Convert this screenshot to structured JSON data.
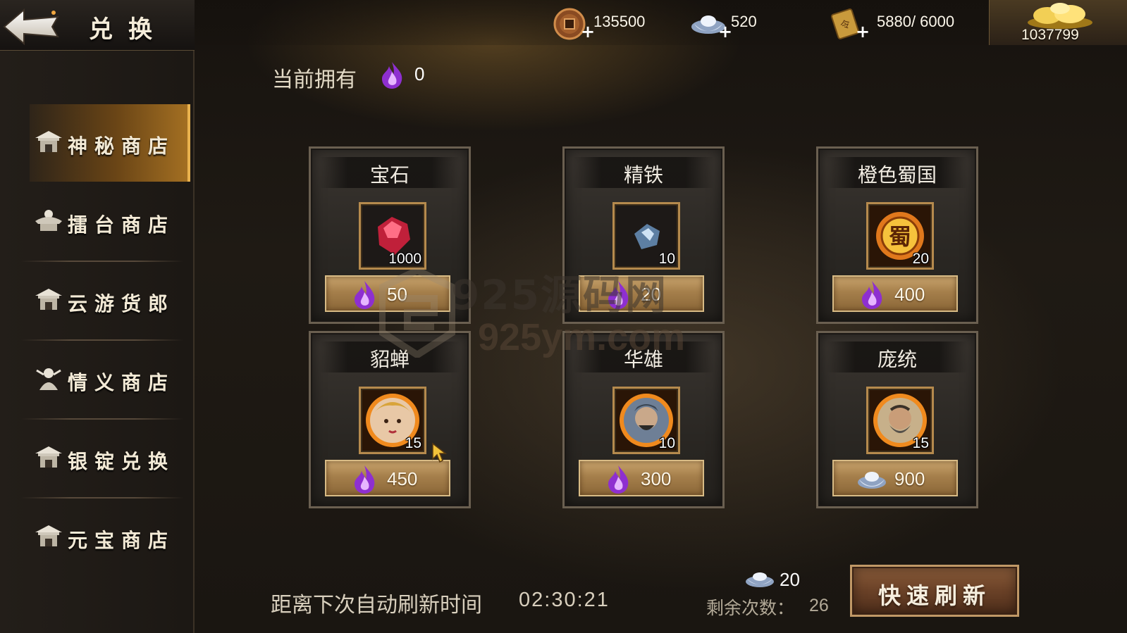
{
  "header": {
    "title": "兑换",
    "resources": [
      {
        "name": "copper-coin",
        "value": "135500"
      },
      {
        "name": "silver-ingot",
        "value": "520"
      },
      {
        "name": "stamina-scroll",
        "value": "5880/ 6000"
      }
    ],
    "gold": {
      "value": "1037799"
    }
  },
  "sidebar": {
    "items": [
      {
        "label": "神秘商店",
        "icon": "shop-pavilion-icon",
        "active": true
      },
      {
        "label": "擂台商店",
        "icon": "arena-icon",
        "active": false
      },
      {
        "label": "云游货郎",
        "icon": "shop-pavilion-icon",
        "active": false
      },
      {
        "label": "情义商店",
        "icon": "hero-bust-icon",
        "active": false
      },
      {
        "label": "银锭兑换",
        "icon": "shop-pavilion-icon",
        "active": false
      },
      {
        "label": "元宝商店",
        "icon": "shop-pavilion-icon",
        "active": false
      }
    ]
  },
  "owned": {
    "label": "当前拥有",
    "currency_icon": "purple-flame-icon",
    "value": "0"
  },
  "cards": [
    {
      "title": "宝石",
      "item": "red-gem",
      "qty": "1000",
      "price": "50",
      "price_currency": "purple-flame"
    },
    {
      "title": "精铁",
      "item": "refined-iron",
      "qty": "10",
      "price": "20",
      "price_currency": "purple-flame"
    },
    {
      "title": "橙色蜀国",
      "item": "shu-token",
      "qty": "20",
      "price": "400",
      "price_currency": "purple-flame"
    },
    {
      "title": "貂蝉",
      "item": "diaochan-portrait",
      "qty": "15",
      "price": "450",
      "price_currency": "purple-flame"
    },
    {
      "title": "华雄",
      "item": "huaxiong-portrait",
      "qty": "10",
      "price": "300",
      "price_currency": "purple-flame"
    },
    {
      "title": "庞统",
      "item": "pangtong-portrait",
      "qty": "15",
      "price": "900",
      "price_currency": "silver-ingot"
    }
  ],
  "footer": {
    "refresh_label": "距离下次自动刷新时间",
    "refresh_time": "02:30:21",
    "refresh_cost": "20",
    "remaining_label": "剩余次数：",
    "remaining_value": "26",
    "quick_refresh_label": "快速刷新"
  },
  "watermark": {
    "cn": "925源码网",
    "url": "925ym.com"
  },
  "colors": {
    "accent_gold": "#e9b24e",
    "purple_flame": "#9b3fd6",
    "panel": "#2a2723"
  }
}
